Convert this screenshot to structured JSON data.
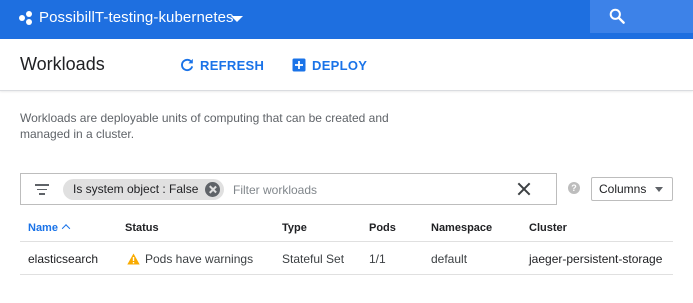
{
  "topbar": {
    "project_name": "PossibillT-testing-kubernetes",
    "accent_color": "#1e6fe0",
    "project_icon": "project-dots-icon",
    "search_icon": "search-icon"
  },
  "header": {
    "title": "Workloads",
    "refresh_label": "REFRESH",
    "deploy_label": "DEPLOY"
  },
  "description": "Workloads are deployable units of computing that can be created and managed in a cluster.",
  "filter": {
    "chip_key": "Is system object",
    "chip_separator": " : ",
    "chip_value": "False",
    "placeholder": "Filter workloads"
  },
  "columns_button": "Columns",
  "help_icon_text": "?",
  "table": {
    "headers": {
      "name": "Name",
      "status": "Status",
      "type": "Type",
      "pods": "Pods",
      "namespace": "Namespace",
      "cluster": "Cluster"
    },
    "sorted_by": "name",
    "rows": [
      {
        "name": "elasticsearch",
        "status": "Pods have warnings",
        "status_icon": "warning-icon",
        "type": "Stateful Set",
        "pods": "1/1",
        "namespace": "default",
        "cluster": "jaeger-persistent-storage"
      }
    ]
  }
}
